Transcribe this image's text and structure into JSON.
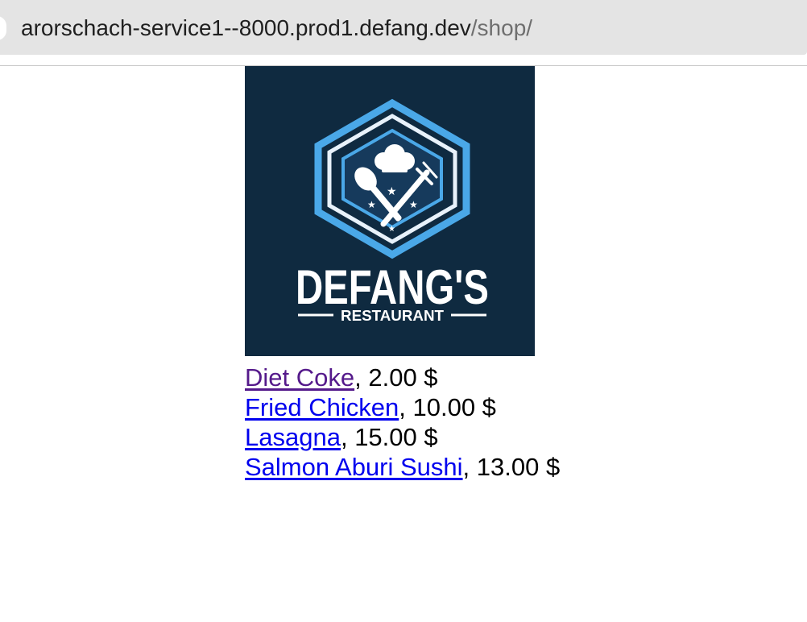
{
  "browser": {
    "url_host": "arorschach-service1--8000.prod1.defang.dev",
    "url_path": "/shop/"
  },
  "logo": {
    "brand": "DEFANG'S",
    "subtitle": "RESTAURANT",
    "background_color": "#0f2a40",
    "accent_color": "#4aa8e8"
  },
  "menu": {
    "separator": ", ",
    "currency": " $",
    "items": [
      {
        "name": "Diet Coke",
        "price": "2.00",
        "visited": true
      },
      {
        "name": "Fried Chicken",
        "price": "10.00",
        "visited": false
      },
      {
        "name": "Lasagna",
        "price": "15.00",
        "visited": false
      },
      {
        "name": "Salmon Aburi Sushi",
        "price": "13.00",
        "visited": false
      }
    ]
  }
}
